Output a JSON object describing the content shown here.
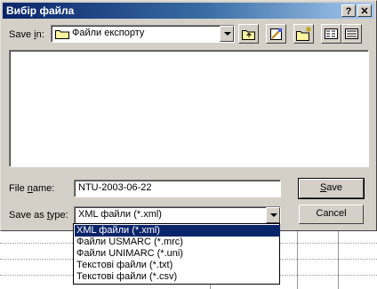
{
  "dialog": {
    "title": "Вибір файла",
    "help_label": "?",
    "close_label": "✕"
  },
  "save_in": {
    "label_underlined": "Save ",
    "label_key": "i",
    "label_rest": "n:",
    "folder": "Файли експорту"
  },
  "toolbar": {
    "icons": [
      "up-one-level-icon",
      "favorites-icon",
      "new-folder-icon",
      "list-view-icon",
      "details-view-icon"
    ]
  },
  "file_name": {
    "label_pre": "File ",
    "label_key": "n",
    "label_rest": "ame:",
    "value": "NTU-2003-06-22"
  },
  "save_as_type": {
    "label_pre": "Save as ",
    "label_key": "t",
    "label_rest": "ype:",
    "value": "XML файли (*.xml)",
    "options": [
      "XML файли (*.xml)",
      "Файли USMARC (*.mrc)",
      "Файли UNIMARC (*.uni)",
      "Текстові файли (*.txt)",
      "Текстові файли (*.csv)"
    ],
    "selected_index": 0
  },
  "buttons": {
    "save_key": "S",
    "save_rest": "ave",
    "cancel": "Cancel"
  },
  "colors": {
    "title_gradient_start": "#0a246a",
    "title_gradient_end": "#a6caf0",
    "selection": "#0a246a",
    "face": "#d4d0c8"
  }
}
